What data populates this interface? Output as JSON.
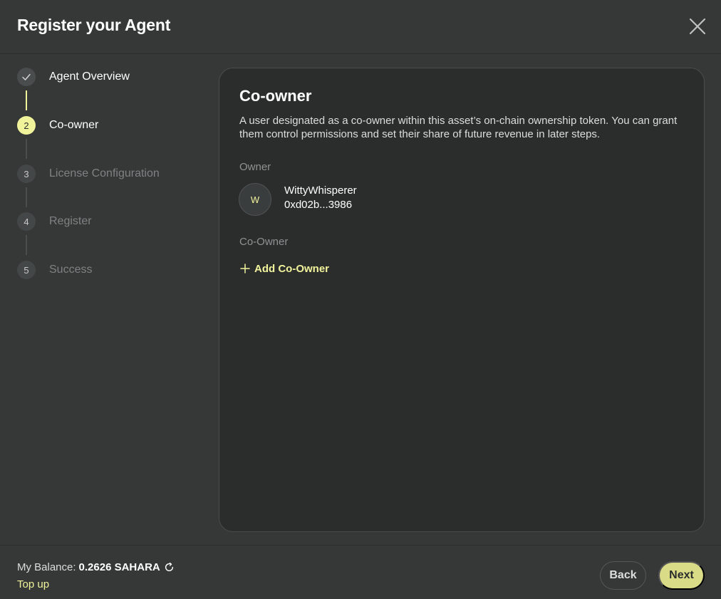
{
  "header": {
    "title": "Register your Agent",
    "close_icon": "close-icon"
  },
  "steps": [
    {
      "number": "1",
      "label": "Agent Overview",
      "state": "done",
      "icon": "check-icon"
    },
    {
      "number": "2",
      "label": "Co-owner",
      "state": "active"
    },
    {
      "number": "3",
      "label": "License Configuration",
      "state": "pending"
    },
    {
      "number": "4",
      "label": "Register",
      "state": "pending"
    },
    {
      "number": "5",
      "label": "Success",
      "state": "pending"
    }
  ],
  "main": {
    "title": "Co-owner",
    "description": "A user designated as a co-owner within this asset’s on-chain ownership token. You can grant them control permissions and set their share of future revenue in later steps.",
    "owner_label": "Owner",
    "owner": {
      "avatar_initial": "W",
      "name": "WittyWhisperer",
      "address": "0xd02b...3986"
    },
    "coowner_label": "Co-Owner",
    "add_coowner_label": "Add Co-Owner"
  },
  "footer": {
    "balance_label": "My Balance:",
    "balance_value": "0.2626 SAHARA",
    "topup_label": "Top up",
    "back_label": "Back",
    "next_label": "Next"
  },
  "colors": {
    "accent": "#f1f39b",
    "next_button": "#d9db86",
    "background": "#363838",
    "card": "#2b2d2d"
  }
}
